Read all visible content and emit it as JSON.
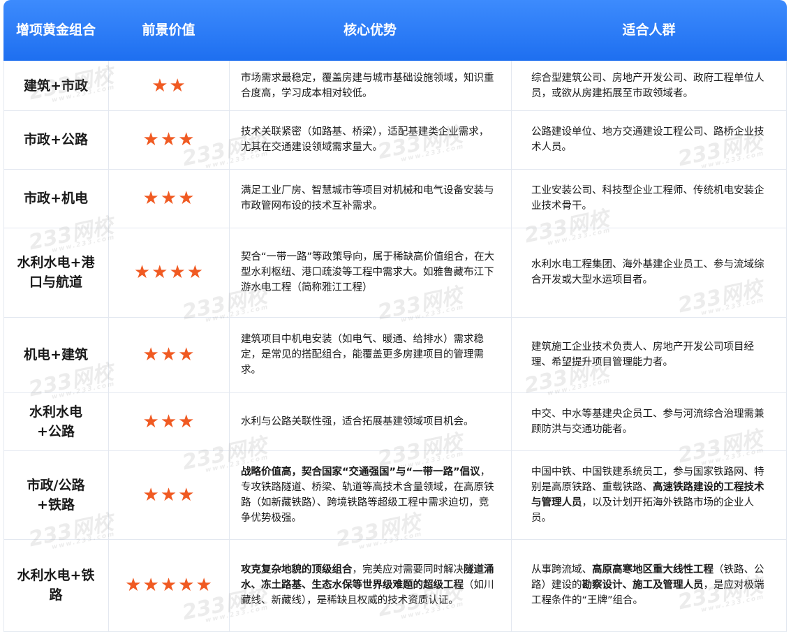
{
  "header": {
    "col1": "增项黄金组合",
    "col2": "前景价值",
    "col3": "核心优势",
    "col4": "适合人群"
  },
  "rows": [
    {
      "combo": "建筑+市政",
      "stars": "★★",
      "star_count": 2,
      "advantage": "市场需求最稳定，覆盖房建与城市基础设施领域，知识重合度高，学习成本相对较低。",
      "audience": "综合型建筑公司、房地产开发公司、政府工程单位人员，或欲从房建拓展至市政领域者。"
    },
    {
      "combo": "市政+公路",
      "stars": "★★★",
      "star_count": 3,
      "advantage": "技术关联紧密（如路基、桥梁），适配基建类企业需求，尤其在交通建设领域需求量大。",
      "audience": "公路建设单位、地方交通建设工程公司、路桥企业技术人员。"
    },
    {
      "combo": "市政+机电",
      "stars": "★★★",
      "star_count": 3,
      "advantage": "满足工业厂房、智慧城市等项目对机械和电气设备安装与市政管网布设的技术互补需求。",
      "audience": "工业安装公司、科技型企业工程师、传统机电安装企业技术骨干。"
    },
    {
      "combo": "水利水电+港口与航道",
      "stars": "★★★★",
      "star_count": 4,
      "advantage": "契合“一带一路”等政策导向，属于稀缺高价值组合，在大型水利枢纽、港口疏浚等工程中需求大。如雅鲁藏布江下游水电工程（简称雅江工程）",
      "audience": "水利水电工程集团、海外基建企业员工、参与流域综合开发或大型水运项目者。"
    },
    {
      "combo": "机电+建筑",
      "stars": "★★★",
      "star_count": 3,
      "advantage": "建筑项目中机电安装（如电气、暖通、给排水）需求稳定，是常见的搭配组合，能覆盖更多房建项目的管理需求。",
      "audience": "建筑施工企业技术负责人、房地产开发公司项目经理、希望提升项目管理能力者。"
    },
    {
      "combo": "水利水电+公路",
      "stars": "★★★",
      "star_count": 3,
      "advantage": "水利与公路关联性强，适合拓展基建领域项目机会。",
      "audience": "中交、中水等基建央企员工、参与河流综合治理需兼顾防洪与交通功能者。"
    },
    {
      "combo": "市政/公路+铁路",
      "stars": "★★★",
      "star_count": 3,
      "advantage_bold1": "战略价值高，契合国家“交通强国”与“一带一路”倡议",
      "advantage_rest1": "，专攻铁路隧道、桥梁、轨道等高技术含量领域，在高原铁路（如新藏铁路）、跨境铁路等超级工程中需求迫切，竞争优势极强。",
      "audience_part1": "中国中铁、中国铁建系统员工，参与国家铁路网、特别是高原铁路、重载铁路、",
      "audience_bold1": "高速铁路建设的工程技术与管理人员",
      "audience_part2": "，以及计划开拓海外铁路市场的企业人员。"
    },
    {
      "combo": "水利水电+铁路",
      "stars": "★★★★★",
      "star_count": 5,
      "advantage_bold1": "攻克复杂地貌的顶级组合",
      "advantage_part1": "，完美应对需要同时解决",
      "advantage_bold2": "隧道涌水、冻土路基、生态水保等世界级难题的超级工程",
      "advantage_part2": "（如川藏线、新藏线），是稀缺且权威的技术资质认证。",
      "audience_part1": "从事跨流域、",
      "audience_bold1": "高原高寒地区重大线性工程",
      "audience_part2": "（铁路、公路）建设的",
      "audience_bold2": "勘察设计、施工及管理人员",
      "audience_part3": "，是应对极端工程条件的“王牌”组合。"
    }
  ],
  "watermark": {
    "main": "233网校",
    "sub": "www.233.com"
  }
}
